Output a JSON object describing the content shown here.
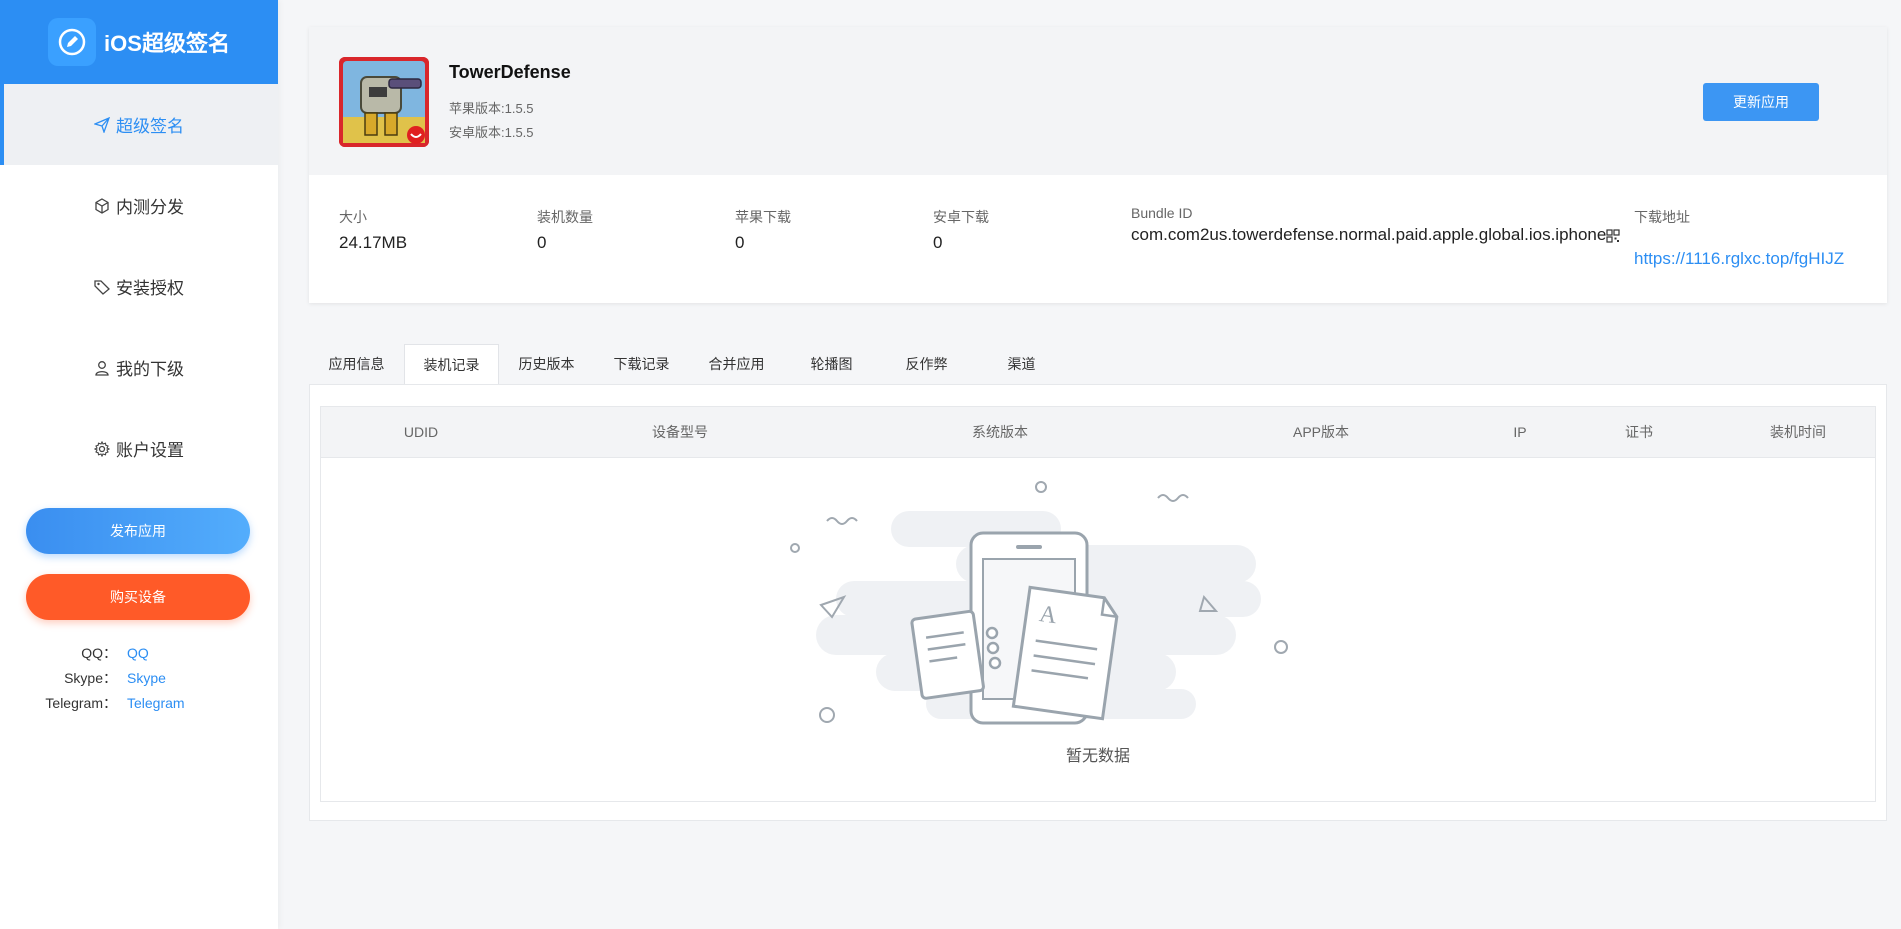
{
  "brand": {
    "title": "iOS超级签名"
  },
  "nav": [
    {
      "label": "超级签名",
      "icon": "send-icon"
    },
    {
      "label": "内测分发",
      "icon": "cube-icon"
    },
    {
      "label": "安装授权",
      "icon": "tag-icon"
    },
    {
      "label": "我的下级",
      "icon": "user-icon"
    },
    {
      "label": "账户设置",
      "icon": "gear-icon"
    }
  ],
  "buttons": {
    "publish": "发布应用",
    "buy": "购买设备",
    "update": "更新应用"
  },
  "contacts": [
    {
      "key": "QQ：",
      "value": "QQ"
    },
    {
      "key": "Skype：",
      "value": "Skype"
    },
    {
      "key": "Telegram：",
      "value": "Telegram"
    }
  ],
  "app": {
    "name": "TowerDefense",
    "ios_version": "苹果版本:1.5.5",
    "android_version": "安卓版本:1.5.5"
  },
  "stats": {
    "size": {
      "label": "大小",
      "value": "24.17MB"
    },
    "installs": {
      "label": "装机数量",
      "value": "0"
    },
    "ios_downloads": {
      "label": "苹果下载",
      "value": "0"
    },
    "android_downloads": {
      "label": "安卓下载",
      "value": "0"
    },
    "bundle": {
      "label": "Bundle ID",
      "value": "com.com2us.towerdefense.normal.paid.apple.global.ios.iphone"
    },
    "download": {
      "label": "下载地址",
      "value": "https://1116.rglxc.top/fgHIJZ"
    }
  },
  "tabs": [
    "应用信息",
    "装机记录",
    "历史版本",
    "下载记录",
    "合并应用",
    "轮播图",
    "反作弊",
    "渠道"
  ],
  "active_tab": "装机记录",
  "table": {
    "columns": [
      "UDID",
      "设备型号",
      "系统版本",
      "APP版本",
      "IP",
      "证书",
      "装机时间"
    ],
    "rows": [],
    "empty_text": "暂无数据"
  },
  "colors": {
    "primary": "#2c8ef3",
    "buy": "#ff5a28",
    "app_icon_bg": "#d9262b"
  }
}
